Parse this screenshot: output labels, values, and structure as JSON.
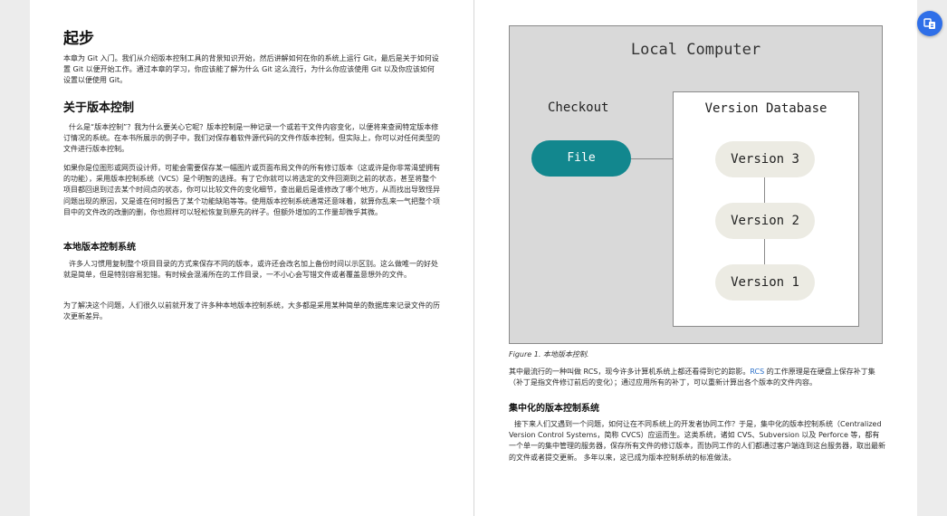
{
  "left_page": {
    "title": "起步",
    "intro": "本章为 Git 入门。我们从介绍版本控制工具的背景知识开始，然后讲解如何在你的系统上运行 Git，最后是关于如何设置 Git 以便开始工作。通过本章的学习，你应该能了解为什么 Git 这么流行，为什么你应该使用 Git 以及你应该如何设置以便使用 Git。",
    "section1_title": "关于版本控制",
    "section1_p1": "什么是“版本控制”？我为什么要关心它呢？版本控制是一种记录一个或若干文件内容变化，以便将来查阅特定版本修订情况的系统。在本书所展示的例子中，我们对保存着软件源代码的文件作版本控制，但实际上，你可以对任何类型的文件进行版本控制。",
    "section1_p2": "如果你是位图形或网页设计师，可能会需要保存某一幅图片或页面布局文件的所有修订版本（这或许是你非常渴望拥有的功能），采用版本控制系统（VCS）是个明智的选择。有了它你就可以将选定的文件回溯到之前的状态，甚至将整个项目都回退到过去某个时间点的状态，你可以比较文件的变化细节，查出最后是谁修改了哪个地方，从而找出导致怪异问题出现的原因，又是谁在何时报告了某个功能缺陷等等。使用版本控制系统通常还意味着，就算你乱来一气把整个项目中的文件改的改删的删，你也照样可以轻松恢复到原先的样子。但额外增加的工作量却微乎其微。",
    "sub1_title": "本地版本控制系统",
    "sub1_p1": "许多人习惯用复制整个项目目录的方式来保存不同的版本，或许还会改名加上备份时间以示区别。这么做唯一的好处就是简单，但是特别容易犯错。有时候会混淆所在的工作目录，一不小心会写错文件或者覆盖意想外的文件。",
    "sub1_p2": "为了解决这个问题，人们很久以前就开发了许多种本地版本控制系统，大多都是采用某种简单的数据库来记录文件的历次更新差异。"
  },
  "figure": {
    "title": "Local Computer",
    "checkout_label": "Checkout",
    "file_label": "File",
    "database_label": "Version Database",
    "versions": [
      "Version 3",
      "Version 2",
      "Version 1"
    ],
    "caption": "Figure 1. 本地版本控制.",
    "colors": {
      "file_fill": "#12878e",
      "version_fill": "#ecebe3",
      "outer_fill": "#d9d9d9"
    }
  },
  "right_page": {
    "p1_before_link": "其中最流行的一种叫做 RCS，现今许多计算机系统上都还看得到它的踪影。",
    "p1_link": "RCS",
    "p1_after_link": " 的工作原理是在硬盘上保存补丁集（补丁是指文件修订前后的变化）；通过应用所有的补丁，可以重新计算出各个版本的文件内容。",
    "sub2_title": "集中化的版本控制系统",
    "sub2_p1": "接下来人们又遇到一个问题，如何让在不同系统上的开发者协同工作？于是，集中化的版本控制系统（Centralized Version Control Systems，简称 CVCS）应运而生。这类系统，诸如 CVS、Subversion 以及 Perforce 等，都有一个单一的集中管理的服务器，保存所有文件的修订版本，而协同工作的人们都通过客户端连到这台服务器，取出最新的文件或者提交更新。 多年以来，这已成为版本控制系统的标准做法。"
  },
  "toolbar": {
    "icon": "translate-icon",
    "accent": "#2f6fe8"
  }
}
